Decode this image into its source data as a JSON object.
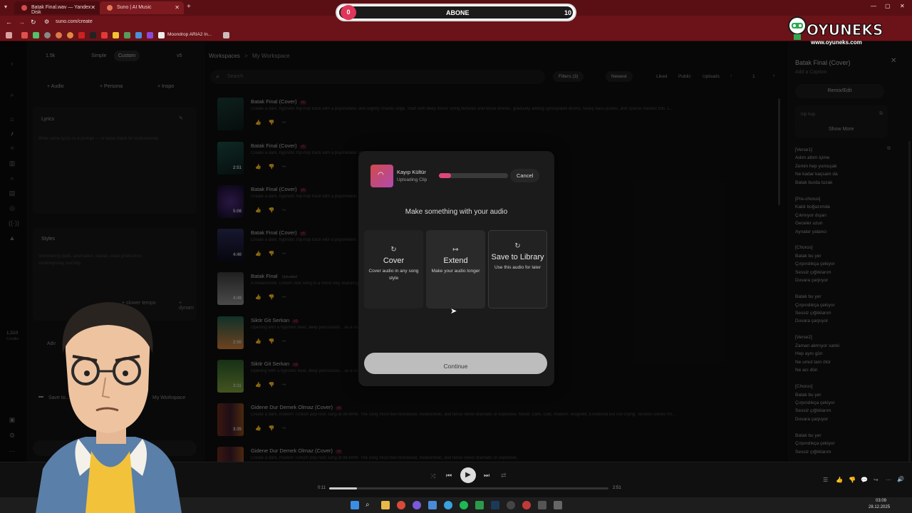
{
  "browser": {
    "tabs": [
      {
        "label": "Batak Final.wav — Yandex Disk",
        "close": "✕"
      },
      {
        "label": "Suno | AI Music",
        "close": "✕"
      }
    ],
    "new_tab": "+",
    "url": "suno.com/create",
    "bookmark": "Moondrop ARIA2 In..."
  },
  "banner": {
    "left_count": "0",
    "label": "ABONE",
    "right_count": "10"
  },
  "watermark": {
    "brand": "OYUNEKS",
    "site": "www.oyuneks.com"
  },
  "create_panel": {
    "credits_chip": "1.5k",
    "mode_simple": "Simple",
    "mode_custom": "Custom",
    "version": "v5",
    "add_audio": "+ Audio",
    "add_persona": "+ Persona",
    "add_inspo": "+ Inspo",
    "lyrics_label": "Lyrics",
    "lyrics_placeholder": "Write some lyrics or a prompt — or leave blank for instrumental",
    "styles_label": "Styles",
    "styles_text": "shimmering pads, anemalien, kawaii, clean production, contemporary worship",
    "style_chip_1": "+ slower tempo",
    "style_chip_2": "+ dynam",
    "advanced_label": "Adv",
    "save_to": "Save to...",
    "my_workspace": "My Workspace",
    "credits_count": "1,510",
    "credits_label": "Credits"
  },
  "workspace": {
    "breadcrumb_root": "Workspaces",
    "breadcrumb_sep": ">",
    "breadcrumb_current": "My Workspace",
    "search_placeholder": "Search",
    "filters": "Filters (3)",
    "sort": "Newest",
    "liked": "Liked",
    "public": "Public",
    "uploads": "Uploads",
    "page": "1",
    "songs": [
      {
        "title": "Batak Final (Cover)",
        "tag": "v5",
        "desc": "Create a dark, hypnotic trip-hop track with a psychedelic and slightly chaotic edge. Start with deep mirror string textures and tense drones, gradually adding syncopated drums, heavy bass pulses, and sparse metallic hits. L...",
        "duration": ""
      },
      {
        "title": "Batak Final (Cover)",
        "tag": "v5",
        "desc": "Create a dark, hypnotic trip-hop track with a psychedelic and slightly chaotic edge.",
        "duration": "2:51"
      },
      {
        "title": "Batak Final (Cover)",
        "tag": "v5",
        "desc": "Create a dark, hypnotic trip-hop track with a psychedelic and slightly chaotic edge.",
        "duration": "5:08"
      },
      {
        "title": "Batak Final (Cover)",
        "tag": "v5",
        "desc": "Create a dark, hypnotic trip-hop track with a psychedelic and slightly chaotic edge.",
        "duration": "4:40"
      },
      {
        "title": "Batak Final",
        "tag": "Uploaded",
        "desc": "A melancholic Turkish rock song in a minor key, featuring... The acoustic guitar plays a premise...",
        "duration": "4:49"
      },
      {
        "title": "Siktir Git Serkan",
        "tag": "v5",
        "desc": "Opening with a hypnotic beat, deep percussion... as a soulful clarinet weaves modal melodies throughout, bein ke...",
        "duration": "2:50"
      },
      {
        "title": "Siktir Git Serkan",
        "tag": "v5",
        "desc": "Opening with a hypnotic beat, deep percussion... as a soulful clarinet weaves modal melodies throughout, from sa...",
        "duration": "3:11"
      },
      {
        "title": "Gidene Dur Demek Olmaz (Cover)",
        "tag": "v5",
        "desc": "Create a dark, modern Turkish pop-rock song at 98 BPM. The song must feel restrained, melancholic, and tense never dramatic or explosive. Mood: Dark, cold, modern, resigned. Emotional but not crying. Tension comes fro...",
        "duration": "3:35"
      },
      {
        "title": "Gidene Dur Demek Olmaz (Cover)",
        "tag": "v5",
        "desc": "Create a dark, modern Turkish pop-rock song at 98 BPM. The song must feel restrained, melancholic, and tense never dramatic or explosive.",
        "duration": ""
      }
    ]
  },
  "modal": {
    "artist": "Kayıp Kültür",
    "status": "Uploading Clip",
    "progress": 0.18,
    "cancel": "Cancel",
    "heading": "Make something with your audio",
    "options": [
      {
        "title": "Cover",
        "desc": "Cover audio in any song style",
        "icon": "↻"
      },
      {
        "title": "Extend",
        "desc": "Make your audio longer",
        "icon": "↦"
      },
      {
        "title": "Save to Library",
        "desc": "Use this audio for later",
        "icon": "↻"
      }
    ],
    "continue": "Continue"
  },
  "detail": {
    "title": "Batak Final (Cover)",
    "caption": "Add a Caption",
    "remix": "Remix/Edit",
    "style_tag": "trip hop",
    "show_more": "Show More",
    "lyrics": [
      "[Verse1]",
      "Adım attım içime",
      "Zemin hep yumuşak",
      "Ne kadar kaçsam da",
      "Batak burda tuzak",
      "",
      "[Pre-chorus]",
      "Kaldı boğazımda",
      "Çıkmıyor dışarı",
      "Geceler uzun",
      "Aynalar yalancı",
      "",
      "[Chorus]",
      "Batak bu yer",
      "Çırpındıkça çekiyor",
      "Sessiz çığlıklarım",
      "Duvara çarpıyor",
      "",
      "Batak bu yer",
      "Çırpındıkça çekiyor",
      "Sessiz çığlıklarım",
      "Duvara çarpıyor",
      "",
      "[Verse2]",
      "Zaman akmıyor sanki",
      "Hep aynı gün",
      "Ne umut tam ölür",
      "Ne acı dün",
      "",
      "[Chorus]",
      "Batak bu yer",
      "Çırpındıkça çekiyor",
      "Sessiz çığlıklarım",
      "Duvara çarpıyor",
      "",
      "Batak bu yer",
      "Çırpındıkça çekiyor",
      "Sessiz çığlıklarım"
    ]
  },
  "player": {
    "elapsed": "0:11",
    "total": "2:51",
    "progress": 0.1
  },
  "taskbar": {
    "time": "03:09",
    "date": "28.12.2025"
  },
  "colors": {
    "accent": "#e0457b",
    "browser_red": "#6b1318",
    "modal_bg": "#1b1b1b"
  }
}
